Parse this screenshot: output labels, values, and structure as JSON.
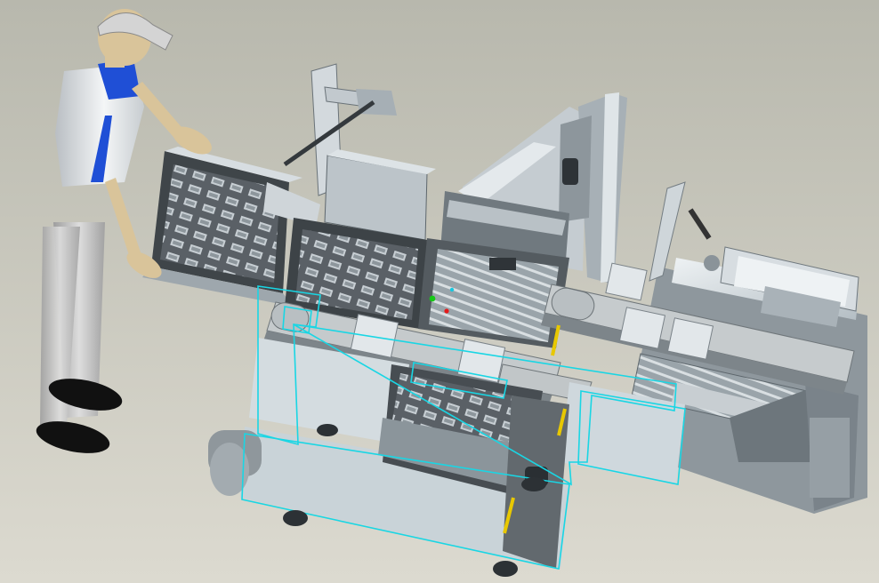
{
  "viewport": {
    "background_top": "#b8b8ad",
    "background_bottom": "#dcdad0"
  },
  "colors": {
    "frame_light": "#e6ebee",
    "frame_mid": "#b7c0c6",
    "frame_dark": "#7b858c",
    "frame_shadow": "#4c5358",
    "selection_outline": "#19d6e4",
    "belt": "#c3c7c9",
    "humanoid_skin": "#d9c49a",
    "humanoid_shirt": "#eef0f2",
    "humanoid_sleeve": "#1f4fd6",
    "humanoid_pants": "#bdbdbd",
    "humanoid_cap": "#d4d4d4",
    "humanoid_shoes": "#111111",
    "marker_green": "#16c916",
    "marker_red": "#e41b1b",
    "marker_cyan": "#17c7df",
    "caution": "#e8c800"
  },
  "scene": {
    "subjects": [
      "mannequin-figure",
      "packaging-machine-assembly"
    ],
    "selected_component": "lower-frame-assembly"
  }
}
